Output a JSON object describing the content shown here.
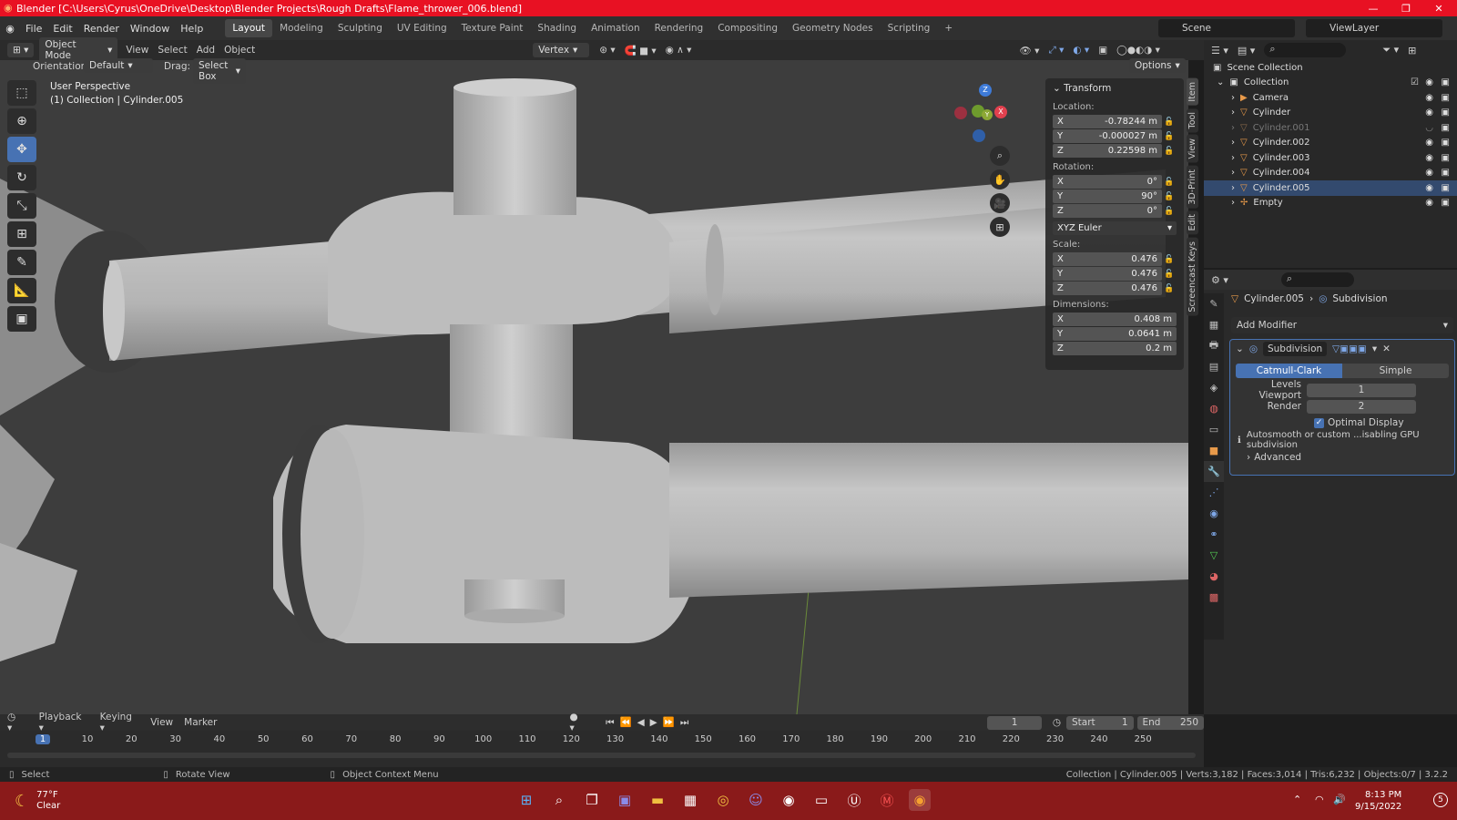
{
  "window": {
    "title": "Blender [C:\\Users\\Cyrus\\OneDrive\\Desktop\\Blender Projects\\Rough Drafts\\Flame_thrower_006.blend]"
  },
  "menus": [
    "File",
    "Edit",
    "Render",
    "Window",
    "Help"
  ],
  "workspaces": [
    "Layout",
    "Modeling",
    "Sculpting",
    "UV Editing",
    "Texture Paint",
    "Shading",
    "Animation",
    "Rendering",
    "Compositing",
    "Geometry Nodes",
    "Scripting"
  ],
  "scene": {
    "scene_name": "Scene",
    "view_layer": "ViewLayer"
  },
  "header": {
    "mode": "Object Mode",
    "view": "View",
    "select": "Select",
    "add": "Add",
    "object": "Object",
    "snap_target": "Vertex",
    "orientation_label": "Orientation:",
    "orientation": "Default",
    "drag_label": "Drag:",
    "drag": "Select Box",
    "options": "Options"
  },
  "viewport": {
    "perspective": "User Perspective",
    "collection_info": "(1) Collection | Cylinder.005"
  },
  "npanel": {
    "title": "Transform",
    "location_label": "Location:",
    "location": {
      "x": "-0.78244 m",
      "y": "-0.000027 m",
      "z": "0.22598 m"
    },
    "rotation_label": "Rotation:",
    "rotation": {
      "x": "0°",
      "y": "90°",
      "z": "0°"
    },
    "rotation_mode": "XYZ Euler",
    "scale_label": "Scale:",
    "scale": {
      "x": "0.476",
      "y": "0.476",
      "z": "0.476"
    },
    "dimensions_label": "Dimensions:",
    "dimensions": {
      "x": "0.408 m",
      "y": "0.0641 m",
      "z": "0.2 m"
    },
    "axis": {
      "x": "X",
      "y": "Y",
      "z": "Z"
    }
  },
  "side_tabs": [
    "Item",
    "Tool",
    "View",
    "3D-Print",
    "Edit",
    "Screencast Keys"
  ],
  "outliner": {
    "root": "Scene Collection",
    "collection": "Collection",
    "items": [
      {
        "name": "Camera",
        "dim": false
      },
      {
        "name": "Cylinder",
        "dim": false
      },
      {
        "name": "Cylinder.001",
        "dim": true
      },
      {
        "name": "Cylinder.002",
        "dim": false
      },
      {
        "name": "Cylinder.003",
        "dim": false
      },
      {
        "name": "Cylinder.004",
        "dim": false
      },
      {
        "name": "Cylinder.005",
        "dim": false
      },
      {
        "name": "Empty",
        "dim": false
      }
    ]
  },
  "properties": {
    "object": "Cylinder.005",
    "modifier_context": "Subdivision",
    "add_modifier": "Add Modifier",
    "modifier_name": "Subdivision",
    "catmull": "Catmull-Clark",
    "simple": "Simple",
    "levels_viewport_label": "Levels Viewport",
    "levels_viewport": "1",
    "render_label": "Render",
    "render": "2",
    "optimal_display": "Optimal Display",
    "warning": "Autosmooth or custom ...isabling GPU subdivision",
    "advanced": "Advanced"
  },
  "timeline": {
    "playback": "Playback",
    "keying": "Keying",
    "view": "View",
    "marker": "Marker",
    "current_frame": "1",
    "start_label": "Start",
    "start": "1",
    "end_label": "End",
    "end": "250",
    "ticks": [
      "1",
      "10",
      "20",
      "30",
      "40",
      "50",
      "60",
      "70",
      "80",
      "90",
      "100",
      "110",
      "120",
      "130",
      "140",
      "150",
      "160",
      "170",
      "180",
      "190",
      "200",
      "210",
      "220",
      "230",
      "240",
      "250"
    ]
  },
  "status": {
    "select": "Select",
    "rotate": "Rotate View",
    "context": "Object Context Menu",
    "stats": "Collection | Cylinder.005 | Verts:3,182 | Faces:3,014 | Tris:6,232 | Objects:0/7 | 3.2.2"
  },
  "taskbar": {
    "temp": "77°F",
    "weather": "Clear",
    "time": "8:13 PM",
    "date": "9/15/2022",
    "badge": "5"
  },
  "colors": {
    "accent": "#4772b3",
    "titlebar": "#e81123",
    "taskbar": "#8a1a1a",
    "viewport": "#3d3d3d"
  }
}
